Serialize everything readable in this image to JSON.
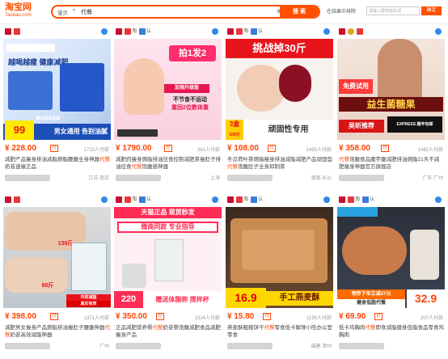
{
  "header": {
    "logo_line1": "淘宝网",
    "logo_line2": "Taobao.com",
    "search_scope": "宝贝",
    "search_value": "代餐",
    "search_button": "搜 索",
    "subsearch_label": "在结果中排除",
    "subsearch_placeholder": "请输入要排除的词",
    "confirm_button": "确定"
  },
  "products": [
    {
      "price": "¥ 228.00",
      "paid": "1710人付款",
      "title_pre": "减肥产品瘦身排油减脂燃脂腰腹全身神器",
      "title_hl": "代餐",
      "title_post": "奶昔速瘦正品",
      "location": "江苏 南京",
      "banner_a": "越喝越瘦 健康减肥",
      "banner_b": "男女通用 告别油腻",
      "banner_c": "99",
      "banner_d": "满60原本包邮",
      "icons": [
        "mail",
        "red"
      ]
    },
    {
      "price": "¥ 1790.00",
      "paid": "361人付款",
      "title_pre": "减肥药瘦身燃脂排油压食控制减肥茶瘦肚子排油控食",
      "title_hl": "代餐",
      "title_post": "饱腹感神器",
      "location": "上海",
      "banner_a": "拍1发2",
      "banner_b": "不节食不运动",
      "banner_c": "重回2位数体重",
      "banner_d": "加强升级版",
      "icons": [
        "mail",
        "red",
        "blue"
      ]
    },
    {
      "price": "¥ 108.00",
      "paid": "1495人付款",
      "title_pre": "冬瓜荷叶茶燃脂瘦身排油减脂减肥产品顽固型",
      "title_hl": "代餐",
      "title_post": "饱腹肚子全身抑制茶",
      "location": "湖南 长沙",
      "banner_a": "挑战掉30斤",
      "banner_b": "顽固性专用",
      "banner_c": "3盒",
      "banner_d": "108元",
      "icons": [
        "mail",
        "red",
        "blue"
      ]
    },
    {
      "price": "¥ 358.00",
      "paid": "1482人付款",
      "title_pre": "",
      "title_hl": "代餐",
      "title_post": "饱腹食品魔芋腹减肥排油燃脂21天不减肥瘦身神器官方旗舰店",
      "location": "广东 广州",
      "banner_a": "益生菌糖果",
      "banner_b": "免费试用",
      "banner_c": "吴昕推荐",
      "banner_d": "EXPRESS 顺丰包邮",
      "icons": [
        "mail",
        "gold",
        "red"
      ]
    },
    {
      "price": "¥ 398.00",
      "paid": "1371人付款",
      "title_pre": "减肥男女瘦身产品燃脂排油瘦肚子腰腹神器",
      "title_hl": "代餐",
      "title_post": "奶昔高效减脂神器",
      "location": "广州",
      "banner_a": "138斤",
      "banner_b": "88斤",
      "banner_c": "中药减脂",
      "banner_d": "真实有效",
      "icons": [
        "mail",
        "red"
      ]
    },
    {
      "price": "¥ 350.00",
      "paid": "2324人付款",
      "title_pre": "正品减肥营养餐",
      "title_hl": "代餐",
      "title_post": "奶昔餐饱腹减肥食品减肥瘦身产品",
      "location": "",
      "banner_a": "天猫正品 现货秒发",
      "banner_b": "微商同款 专业指导",
      "banner_c": "220",
      "banner_d": "赠送体脂称 搅拌杯",
      "icons": [
        "mail",
        "red",
        "blue"
      ]
    },
    {
      "price": "¥ 15.80",
      "paid": "1195人付款",
      "title_pre": "燕麦酥粗粮饼干",
      "title_hl": "代餐",
      "title_post": "零食低卡解馋小吃办公室零食",
      "location": "福建 漳州",
      "banner_a": "16.9",
      "banner_b": "手工燕麦酥",
      "banner_c": "",
      "banner_d": "",
      "icons": [
        "mail",
        "red",
        "blue"
      ]
    },
    {
      "price": "¥ 69.90",
      "paid": "207人付款",
      "title_pre": "低卡鸡胸肉",
      "title_hl": "代餐",
      "title_post": "即食减脂健身低脂食品零食鸡胸肉",
      "location": "",
      "banner_a": "领券下单立减37元",
      "banner_b": "32.9",
      "banner_c": "健身低脂代餐",
      "banner_d": "",
      "icons": [
        "mail",
        "red",
        "blue"
      ]
    }
  ],
  "icon_labels": {
    "tmall": "淘",
    "fav": "认"
  }
}
